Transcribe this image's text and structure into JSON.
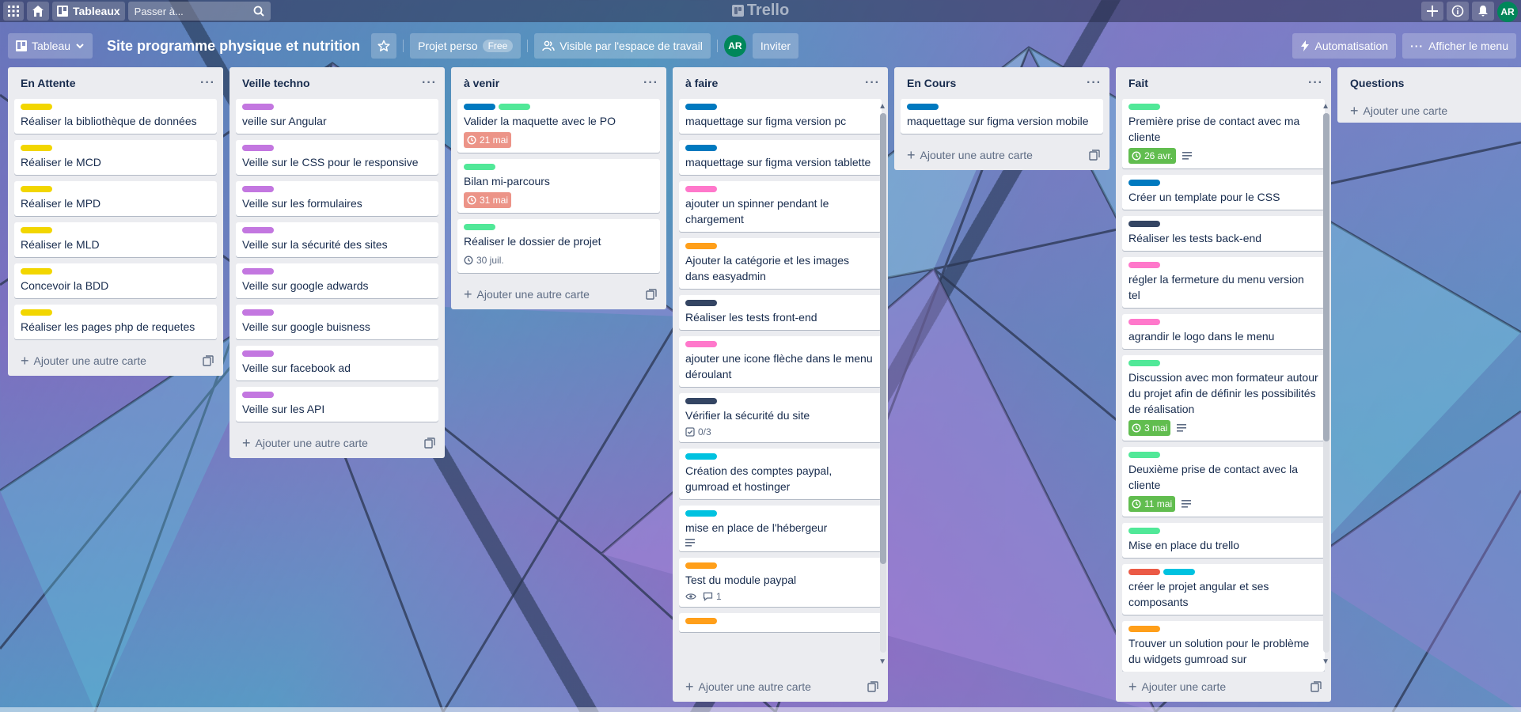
{
  "topbar": {
    "boards_label": "Tableaux",
    "search_placeholder": "Passer à...",
    "logo_text": "Trello",
    "avatar_initials": "AR"
  },
  "boardbar": {
    "view_label": "Tableau",
    "title": "Site programme physique et nutrition",
    "workspace_label": "Projet perso",
    "plan_badge": "Free",
    "visibility_label": "Visible par l'espace de travail",
    "member_initials": "AR",
    "invite_label": "Inviter",
    "automation_label": "Automatisation",
    "menu_label": "Afficher le menu"
  },
  "colors": {
    "yellow": "#f2d600",
    "purple": "#c377e0",
    "blue": "#0079bf",
    "green": "#61bd4f",
    "lime": "#51e898",
    "pink": "#ff78cb",
    "orange": "#ff9f1a",
    "navy": "#344563",
    "sky": "#00c2e0",
    "red": "#eb5a46"
  },
  "lists": [
    {
      "title": "En Attente",
      "add_label": "Ajouter une autre carte",
      "cards": [
        {
          "labels": [
            "yellow"
          ],
          "title": "Réaliser la bibliothèque de données"
        },
        {
          "labels": [
            "yellow"
          ],
          "title": "Réaliser le MCD"
        },
        {
          "labels": [
            "yellow"
          ],
          "title": "Réaliser le MPD"
        },
        {
          "labels": [
            "yellow"
          ],
          "title": "Réaliser le MLD"
        },
        {
          "labels": [
            "yellow"
          ],
          "title": "Concevoir la BDD"
        },
        {
          "labels": [
            "yellow"
          ],
          "title": "Réaliser les pages php de requetes"
        }
      ]
    },
    {
      "title": "Veille techno",
      "add_label": "Ajouter une autre carte",
      "cards": [
        {
          "labels": [
            "purple"
          ],
          "title": "veille sur Angular"
        },
        {
          "labels": [
            "purple"
          ],
          "title": "Veille sur le CSS pour le responsive"
        },
        {
          "labels": [
            "purple"
          ],
          "title": "Veille sur les formulaires"
        },
        {
          "labels": [
            "purple"
          ],
          "title": "Veille sur la sécurité des sites"
        },
        {
          "labels": [
            "purple"
          ],
          "title": "Veille sur google adwards"
        },
        {
          "labels": [
            "purple"
          ],
          "title": "Veille sur google buisness"
        },
        {
          "labels": [
            "purple"
          ],
          "title": "Veille sur facebook ad"
        },
        {
          "labels": [
            "purple"
          ],
          "title": "Veille sur les API"
        }
      ]
    },
    {
      "title": "à venir",
      "add_label": "Ajouter une autre carte",
      "cards": [
        {
          "labels": [
            "blue",
            "lime"
          ],
          "title": "Valider la maquette avec le PO",
          "due": "21 mai",
          "due_style": "red"
        },
        {
          "labels": [
            "lime"
          ],
          "title": "Bilan mi-parcours",
          "due": "31 mai",
          "due_style": "red"
        },
        {
          "labels": [
            "lime"
          ],
          "title": "Réaliser le dossier de projet",
          "due": "30 juil.",
          "due_style": "plain"
        }
      ]
    },
    {
      "title": "à faire",
      "add_label": "Ajouter une autre carte",
      "cards": [
        {
          "labels": [
            "blue"
          ],
          "title": "maquettage sur figma version pc"
        },
        {
          "labels": [
            "blue"
          ],
          "title": "maquettage sur figma version tablette"
        },
        {
          "labels": [
            "pink"
          ],
          "title": "ajouter un spinner pendant le chargement"
        },
        {
          "labels": [
            "orange"
          ],
          "title": "Ajouter la catégorie et les images dans easyadmin"
        },
        {
          "labels": [
            "navy"
          ],
          "title": "Réaliser les tests front-end"
        },
        {
          "labels": [
            "pink"
          ],
          "title": "ajouter une icone flèche dans le menu déroulant"
        },
        {
          "labels": [
            "navy"
          ],
          "title": "Vérifier la sécurité du site",
          "checklist": "0/3"
        },
        {
          "labels": [
            "sky"
          ],
          "title": "Création des comptes paypal, gumroad et hostinger"
        },
        {
          "labels": [
            "sky"
          ],
          "title": "mise en place de l'hébergeur",
          "description": true
        },
        {
          "labels": [
            "orange"
          ],
          "title": "Test du module paypal",
          "watch": true,
          "comments": "1"
        },
        {
          "labels": [
            "orange"
          ],
          "title": ""
        }
      ]
    },
    {
      "title": "En Cours",
      "add_label": "Ajouter une autre carte",
      "cards": [
        {
          "labels": [
            "blue"
          ],
          "title": "maquettage sur figma version mobile"
        }
      ]
    },
    {
      "title": "Fait",
      "add_label": "Ajouter une carte",
      "cards": [
        {
          "labels": [
            "lime"
          ],
          "title": "Première prise de contact avec ma cliente",
          "due": "26 avr.",
          "due_style": "green",
          "description": true
        },
        {
          "labels": [
            "blue"
          ],
          "title": "Créer un template pour le CSS"
        },
        {
          "labels": [
            "navy"
          ],
          "title": "Réaliser les tests back-end"
        },
        {
          "labels": [
            "pink"
          ],
          "title": "régler la fermeture du menu version tel"
        },
        {
          "labels": [
            "pink"
          ],
          "title": "agrandir le logo dans le menu"
        },
        {
          "labels": [
            "lime"
          ],
          "title": "Discussion avec mon formateur autour du projet afin de définir les possibilités de réalisation",
          "due": "3 mai",
          "due_style": "green",
          "description": true
        },
        {
          "labels": [
            "lime"
          ],
          "title": "Deuxième prise de contact avec la cliente",
          "due": "11 mai",
          "due_style": "green",
          "description": true
        },
        {
          "labels": [
            "lime"
          ],
          "title": "Mise en place du trello"
        },
        {
          "labels": [
            "red",
            "sky"
          ],
          "title": "créer le projet angular et ses composants"
        },
        {
          "labels": [
            "orange"
          ],
          "title": "Trouver un solution pour le problème du widgets gumroad sur"
        }
      ]
    },
    {
      "title": "Questions",
      "add_label": "Ajouter une carte",
      "cards": []
    }
  ]
}
